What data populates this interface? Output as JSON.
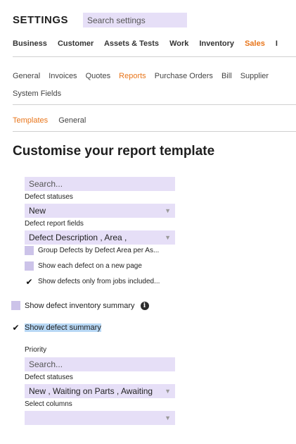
{
  "header": {
    "title": "SETTINGS",
    "search_placeholder": "Search settings"
  },
  "nav_primary": {
    "items": [
      "Business",
      "Customer",
      "Assets & Tests",
      "Work",
      "Inventory",
      "Sales",
      "I"
    ],
    "active": "Sales"
  },
  "nav_secondary": {
    "items": [
      "General",
      "Invoices",
      "Quotes",
      "Reports",
      "Purchase Orders",
      "Bill",
      "Supplier",
      "System Fields"
    ],
    "active": "Reports"
  },
  "nav_tertiary": {
    "items": [
      "Templates",
      "General"
    ],
    "active": "Templates"
  },
  "page_title": "Customise your report template",
  "section_defects": {
    "search_placeholder": "Search...",
    "defect_statuses_label": "Defect statuses",
    "defect_statuses_value": "New",
    "defect_report_fields_label": "Defect report fields",
    "defect_report_fields_value": "Defect Description , Area ,",
    "options": [
      {
        "label": "Group Defects by Defect Area per As...",
        "checked": false
      },
      {
        "label": "Show each defect on a new page",
        "checked": false
      },
      {
        "label": "Show defects only from jobs included...",
        "checked": true
      }
    ]
  },
  "show_inventory_summary": {
    "label": "Show defect inventory summary",
    "checked": false,
    "icon": "info-icon"
  },
  "show_defect_summary": {
    "label": "Show defect summary",
    "checked": true
  },
  "section_summary": {
    "priority_label": "Priority",
    "search_placeholder": "Search...",
    "defect_statuses_label": "Defect statuses",
    "defect_statuses_value": "New , Waiting on Parts , Awaiting",
    "select_columns_label": "Select columns",
    "select_columns_value": ""
  },
  "colors": {
    "accent": "#e8751a",
    "field_bg": "#e6dff7",
    "checkbox_bg": "#ccc3e9",
    "highlight": "#b8d8f5"
  }
}
